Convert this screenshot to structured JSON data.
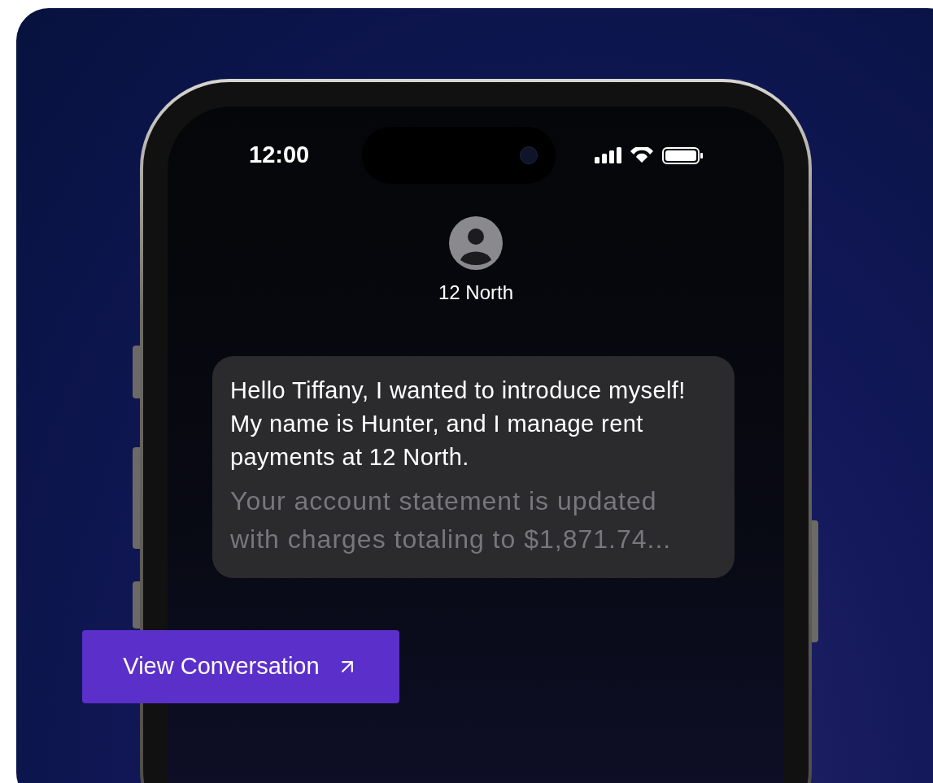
{
  "status_bar": {
    "time": "12:00"
  },
  "contact": {
    "name": "12 North"
  },
  "message": {
    "text": "Hello Tiffany, I wanted to introduce myself! My name is Hunter, and I manage rent payments at 12 North.",
    "preview": "Your account statement is updated with charges totaling to $1,871.74..."
  },
  "button": {
    "label": "View Conversation"
  }
}
